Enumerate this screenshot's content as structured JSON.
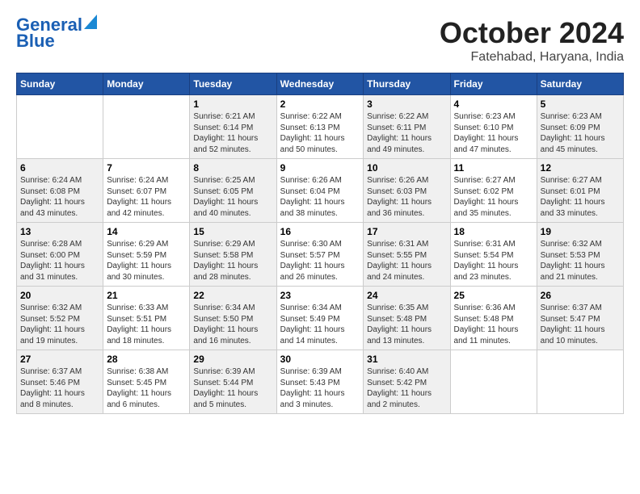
{
  "header": {
    "logo_line1": "General",
    "logo_line2": "Blue",
    "month": "October 2024",
    "location": "Fatehabad, Haryana, India"
  },
  "days_of_week": [
    "Sunday",
    "Monday",
    "Tuesday",
    "Wednesday",
    "Thursday",
    "Friday",
    "Saturday"
  ],
  "weeks": [
    [
      {
        "day": "",
        "info": ""
      },
      {
        "day": "",
        "info": ""
      },
      {
        "day": "1",
        "info": "Sunrise: 6:21 AM\nSunset: 6:14 PM\nDaylight: 11 hours and 52 minutes."
      },
      {
        "day": "2",
        "info": "Sunrise: 6:22 AM\nSunset: 6:13 PM\nDaylight: 11 hours and 50 minutes."
      },
      {
        "day": "3",
        "info": "Sunrise: 6:22 AM\nSunset: 6:11 PM\nDaylight: 11 hours and 49 minutes."
      },
      {
        "day": "4",
        "info": "Sunrise: 6:23 AM\nSunset: 6:10 PM\nDaylight: 11 hours and 47 minutes."
      },
      {
        "day": "5",
        "info": "Sunrise: 6:23 AM\nSunset: 6:09 PM\nDaylight: 11 hours and 45 minutes."
      }
    ],
    [
      {
        "day": "6",
        "info": "Sunrise: 6:24 AM\nSunset: 6:08 PM\nDaylight: 11 hours and 43 minutes."
      },
      {
        "day": "7",
        "info": "Sunrise: 6:24 AM\nSunset: 6:07 PM\nDaylight: 11 hours and 42 minutes."
      },
      {
        "day": "8",
        "info": "Sunrise: 6:25 AM\nSunset: 6:05 PM\nDaylight: 11 hours and 40 minutes."
      },
      {
        "day": "9",
        "info": "Sunrise: 6:26 AM\nSunset: 6:04 PM\nDaylight: 11 hours and 38 minutes."
      },
      {
        "day": "10",
        "info": "Sunrise: 6:26 AM\nSunset: 6:03 PM\nDaylight: 11 hours and 36 minutes."
      },
      {
        "day": "11",
        "info": "Sunrise: 6:27 AM\nSunset: 6:02 PM\nDaylight: 11 hours and 35 minutes."
      },
      {
        "day": "12",
        "info": "Sunrise: 6:27 AM\nSunset: 6:01 PM\nDaylight: 11 hours and 33 minutes."
      }
    ],
    [
      {
        "day": "13",
        "info": "Sunrise: 6:28 AM\nSunset: 6:00 PM\nDaylight: 11 hours and 31 minutes."
      },
      {
        "day": "14",
        "info": "Sunrise: 6:29 AM\nSunset: 5:59 PM\nDaylight: 11 hours and 30 minutes."
      },
      {
        "day": "15",
        "info": "Sunrise: 6:29 AM\nSunset: 5:58 PM\nDaylight: 11 hours and 28 minutes."
      },
      {
        "day": "16",
        "info": "Sunrise: 6:30 AM\nSunset: 5:57 PM\nDaylight: 11 hours and 26 minutes."
      },
      {
        "day": "17",
        "info": "Sunrise: 6:31 AM\nSunset: 5:55 PM\nDaylight: 11 hours and 24 minutes."
      },
      {
        "day": "18",
        "info": "Sunrise: 6:31 AM\nSunset: 5:54 PM\nDaylight: 11 hours and 23 minutes."
      },
      {
        "day": "19",
        "info": "Sunrise: 6:32 AM\nSunset: 5:53 PM\nDaylight: 11 hours and 21 minutes."
      }
    ],
    [
      {
        "day": "20",
        "info": "Sunrise: 6:32 AM\nSunset: 5:52 PM\nDaylight: 11 hours and 19 minutes."
      },
      {
        "day": "21",
        "info": "Sunrise: 6:33 AM\nSunset: 5:51 PM\nDaylight: 11 hours and 18 minutes."
      },
      {
        "day": "22",
        "info": "Sunrise: 6:34 AM\nSunset: 5:50 PM\nDaylight: 11 hours and 16 minutes."
      },
      {
        "day": "23",
        "info": "Sunrise: 6:34 AM\nSunset: 5:49 PM\nDaylight: 11 hours and 14 minutes."
      },
      {
        "day": "24",
        "info": "Sunrise: 6:35 AM\nSunset: 5:48 PM\nDaylight: 11 hours and 13 minutes."
      },
      {
        "day": "25",
        "info": "Sunrise: 6:36 AM\nSunset: 5:48 PM\nDaylight: 11 hours and 11 minutes."
      },
      {
        "day": "26",
        "info": "Sunrise: 6:37 AM\nSunset: 5:47 PM\nDaylight: 11 hours and 10 minutes."
      }
    ],
    [
      {
        "day": "27",
        "info": "Sunrise: 6:37 AM\nSunset: 5:46 PM\nDaylight: 11 hours and 8 minutes."
      },
      {
        "day": "28",
        "info": "Sunrise: 6:38 AM\nSunset: 5:45 PM\nDaylight: 11 hours and 6 minutes."
      },
      {
        "day": "29",
        "info": "Sunrise: 6:39 AM\nSunset: 5:44 PM\nDaylight: 11 hours and 5 minutes."
      },
      {
        "day": "30",
        "info": "Sunrise: 6:39 AM\nSunset: 5:43 PM\nDaylight: 11 hours and 3 minutes."
      },
      {
        "day": "31",
        "info": "Sunrise: 6:40 AM\nSunset: 5:42 PM\nDaylight: 11 hours and 2 minutes."
      },
      {
        "day": "",
        "info": ""
      },
      {
        "day": "",
        "info": ""
      }
    ]
  ]
}
